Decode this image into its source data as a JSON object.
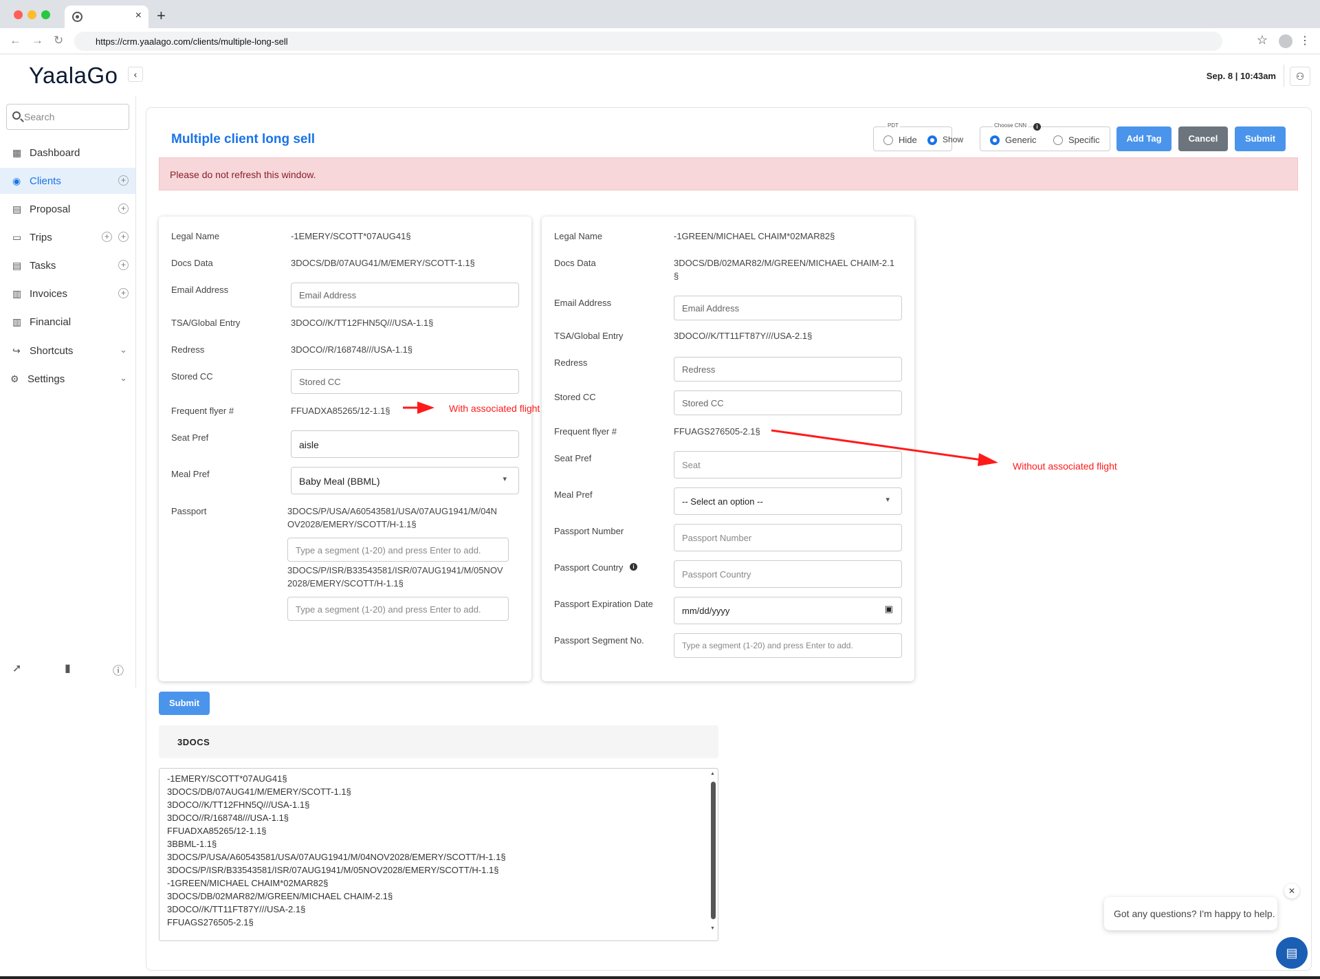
{
  "browser": {
    "url": "https://crm.yaalago.com/clients/multiple-long-sell",
    "tab_close": "×",
    "new_tab": "+"
  },
  "header": {
    "logo": "YaalaGo",
    "date": "Sep. 8 | 10:43am"
  },
  "sidebar": {
    "search_placeholder": "Search",
    "items": [
      {
        "label": "Dashboard",
        "icon": "dashboard-icon"
      },
      {
        "label": "Clients",
        "icon": "clients-icon",
        "active": true
      },
      {
        "label": "Proposal",
        "icon": "proposal-icon"
      },
      {
        "label": "Trips",
        "icon": "trips-icon"
      },
      {
        "label": "Tasks",
        "icon": "tasks-icon"
      },
      {
        "label": "Invoices",
        "icon": "invoices-icon"
      },
      {
        "label": "Financial",
        "icon": "financial-icon"
      },
      {
        "label": "Shortcuts",
        "icon": "shortcuts-icon"
      },
      {
        "label": "Settings",
        "icon": "settings-icon"
      }
    ]
  },
  "page": {
    "title": "Multiple client long sell",
    "pdt": {
      "legend": "PDT",
      "hide": "Hide",
      "show": "Show",
      "selected": "Show"
    },
    "cnn": {
      "legend": "Choose CNN",
      "generic": "Generic",
      "specific": "Specific",
      "selected": "Generic"
    },
    "buttons": {
      "add_tag": "Add Tag",
      "cancel": "Cancel",
      "submit": "Submit"
    },
    "alert": "Please do not refresh this window.",
    "submit_small": "Submit"
  },
  "client1": {
    "legal_name_label": "Legal Name",
    "legal_name": "-1EMERY/SCOTT*07AUG41§",
    "docs_label": "Docs Data",
    "docs": "3DOCS/DB/07AUG41/M/EMERY/SCOTT-1.1§",
    "email_label": "Email Address",
    "email_placeholder": "Email Address",
    "tsa_label": "TSA/Global Entry",
    "tsa": "3DOCO//K/TT12FHN5Q///USA-1.1§",
    "redress_label": "Redress",
    "redress": "3DOCO//R/168748///USA-1.1§",
    "storedcc_label": "Stored CC",
    "storedcc_placeholder": "Stored CC",
    "ff_label": "Frequent flyer #",
    "ff": "FFUADXA85265/12-1.1§",
    "seat_label": "Seat Pref",
    "seat": "aisle",
    "meal_label": "Meal Pref",
    "meal": "Baby Meal (BBML)",
    "passport_label": "Passport",
    "passport1_l1": "3DOCS/P/USA/A60543581/USA/07AUG1941/M/04N",
    "passport1_l2": "OV2028/EMERY/SCOTT/H-1.1§",
    "segment_placeholder": "Type a segment (1-20) and press Enter to add.",
    "passport2_l1": "3DOCS/P/ISR/B33543581/ISR/07AUG1941/M/05NOV",
    "passport2_l2": "2028/EMERY/SCOTT/H-1.1§"
  },
  "client2": {
    "legal_name_label": "Legal Name",
    "legal_name": "-1GREEN/MICHAEL CHAIM*02MAR82§",
    "docs_label": "Docs Data",
    "docs_l1": "3DOCS/DB/02MAR82/M/GREEN/MICHAEL CHAIM-2.1",
    "docs_l2": "§",
    "email_label": "Email Address",
    "email_placeholder": "Email Address",
    "tsa_label": "TSA/Global Entry",
    "tsa": "3DOCO//K/TT11FT87Y///USA-2.1§",
    "redress_label": "Redress",
    "redress_placeholder": "Redress",
    "storedcc_label": "Stored CC",
    "storedcc_placeholder": "Stored CC",
    "ff_label": "Frequent flyer #",
    "ff": "FFUAGS276505-2.1§",
    "seat_label": "Seat Pref",
    "seat_placeholder": "Seat",
    "meal_label": "Meal Pref",
    "meal": "-- Select an option --",
    "pnum_label": "Passport Number",
    "pnum_placeholder": "Passport Number",
    "pcountry_label": "Passport Country",
    "pcountry_placeholder": "Passport Country",
    "pexp_label": "Passport Expiration Date",
    "pexp_placeholder": "mm/dd/yyyy",
    "pseg_label": "Passport Segment No.",
    "pseg_placeholder": "Type a segment (1-20) and press Enter to add."
  },
  "annotations": {
    "with": "With associated flight",
    "without": "Without associated flight",
    "color": "#ff1a1a"
  },
  "docs_section": {
    "title": "3DOCS",
    "lines": [
      "-1EMERY/SCOTT*07AUG41§",
      "3DOCS/DB/07AUG41/M/EMERY/SCOTT-1.1§",
      "3DOCO//K/TT12FHN5Q///USA-1.1§",
      "3DOCO//R/168748///USA-1.1§",
      "FFUADXA85265/12-1.1§",
      "3BBML-1.1§",
      "3DOCS/P/USA/A60543581/USA/07AUG1941/M/04NOV2028/EMERY/SCOTT/H-1.1§",
      "3DOCS/P/ISR/B33543581/ISR/07AUG1941/M/05NOV2028/EMERY/SCOTT/H-1.1§",
      "-1GREEN/MICHAEL CHAIM*02MAR82§",
      "3DOCS/DB/02MAR82/M/GREEN/MICHAEL CHAIM-2.1§",
      "3DOCO//K/TT11FT87Y///USA-2.1§",
      "FFUAGS276505-2.1§"
    ]
  },
  "chat": {
    "message": "Got any questions? I'm happy to help."
  },
  "colors": {
    "accent": "#1a73e8",
    "button_blue": "#4a94ec",
    "button_gray": "#6c757d",
    "alert_bg": "#f8d7da"
  }
}
